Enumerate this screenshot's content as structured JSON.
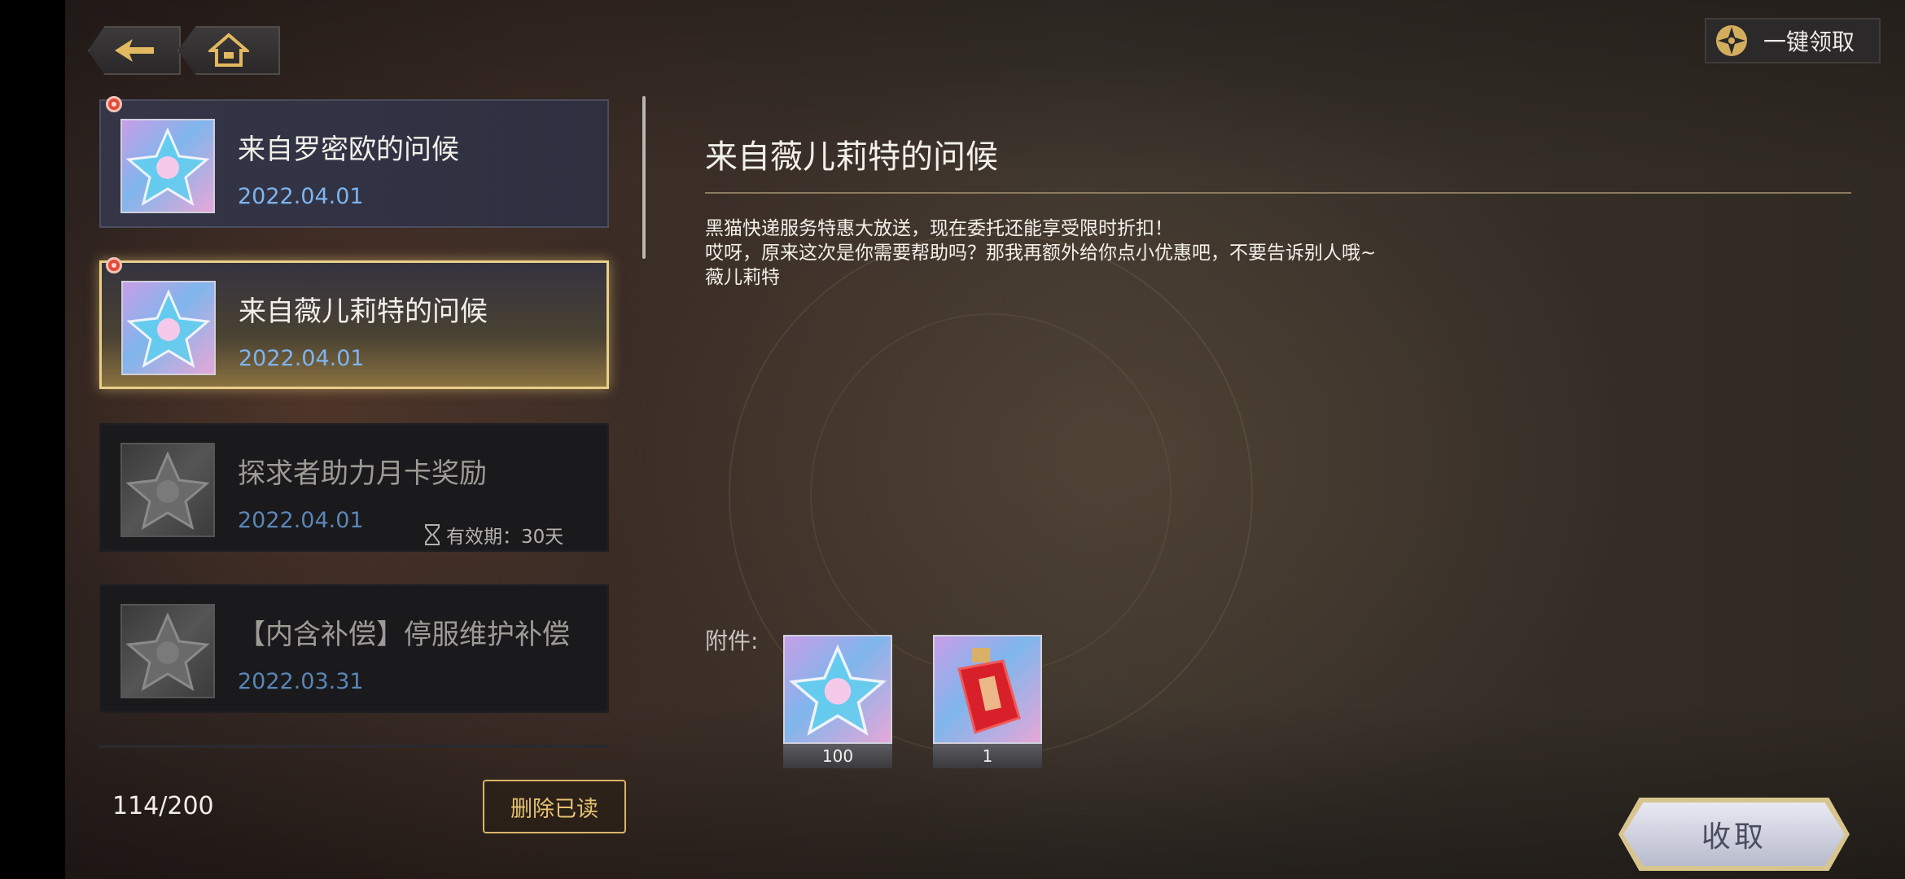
{
  "nav": {
    "back_icon": "back-arrow-icon",
    "home_icon": "home-icon"
  },
  "toolbar": {
    "claim_all_label": "一键领取",
    "claim_all_icon": "compass-icon"
  },
  "mail_list": [
    {
      "title": "来自罗密欧的问候",
      "date": "2022.04.01",
      "unread": true,
      "state": "unread"
    },
    {
      "title": "来自薇儿莉特的问候",
      "date": "2022.04.01",
      "unread": true,
      "state": "selected"
    },
    {
      "title": "探求者助力月卡奖励",
      "date": "2022.04.01",
      "expiry": "有效期：30天",
      "state": "read"
    },
    {
      "title": "【内含补偿】停服维护补偿",
      "date": "2022.03.31",
      "state": "read"
    }
  ],
  "footer": {
    "count": "114/200",
    "delete_read_label": "删除已读"
  },
  "detail": {
    "title": "来自薇儿莉特的问候",
    "body": "黑猫快递服务特惠大放送，现在委托还能享受限时折扣！\n哎呀，原来这次是你需要帮助吗？那我再额外给你点小优惠吧，不要告诉别人哦~\n薇儿莉特",
    "attachments_label": "附件:",
    "attachments": [
      {
        "icon": "star-crystal-icon",
        "quantity": "100"
      },
      {
        "icon": "red-potion-bottle-icon",
        "quantity": "1"
      }
    ],
    "receive_label": "收取"
  },
  "colors": {
    "accent_gold": "#e6c271",
    "date_blue": "#7fb4ef",
    "unread_red": "#e44a36"
  }
}
